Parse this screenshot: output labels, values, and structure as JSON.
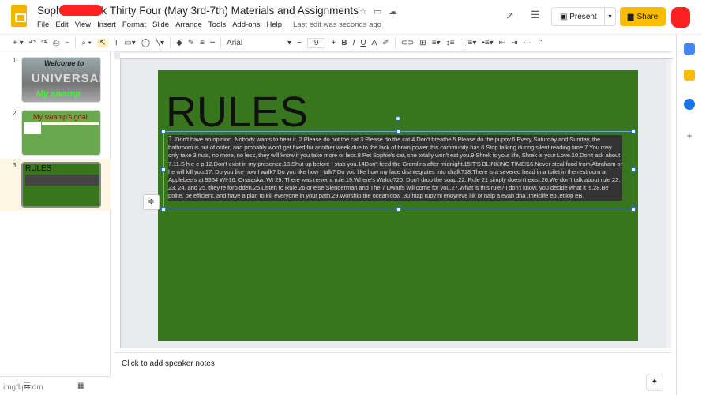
{
  "header": {
    "title": "Sophie      - Week Thirty Four (May 3rd-7th) Materials and Assignments",
    "menu": [
      "File",
      "Edit",
      "View",
      "Insert",
      "Format",
      "Slide",
      "Arrange",
      "Tools",
      "Add-ons",
      "Help"
    ],
    "last_edit": "Last edit was seconds ago",
    "present_label": "Present",
    "share_label": "Share"
  },
  "toolbar": {
    "font": "Arial",
    "font_size": "9",
    "bold": "B",
    "italic": "I",
    "underline": "U"
  },
  "filmstrip": {
    "slides": [
      {
        "number": "1",
        "title": "Welcome to",
        "subtitle": "My swamp",
        "image_text": "UNIVERSAL"
      },
      {
        "number": "2",
        "title": "My swamp's goal"
      },
      {
        "number": "3",
        "title": "RULES"
      }
    ]
  },
  "slide": {
    "title": "RULES",
    "list_number": "1.",
    "rules_text": "Don't have an opinion. Nobody wants to hear it. 2.Please do not the cat 3.Please do the cat.4.Don't breathe.5.Please do the puppy.6.Every Saturday and Sunday, the bathroom is out of order, and probably won't get fixed for another week due to the lack of brain power this community has.6.Stop talking during silent reading time.7.You may only take 3 nuts, no more, no less, they will know if you take more or less.8.Pet Sophie's cat, she totally won't eat you.9.Shrek is your life, Shrek is your Love.10.Don't ask about 7.11.S h e e p.12.Don't exist  in my presence.13.Shut up before I stab you.14Don't feed the Gremlins after midnight.15IT'S BLINKING TIME!16.Never steal food from Abraham or he will kill you.17. Do you like how I walk? Do you like how I talk? Do you like how my face disintegrates into chalk?18.There is a severed head in a toilet in the restroom at Applebee's at 9364 WI-16, Onalaska, WI 29; There was never a rule.19.Where's Waldo?20. Don't drop the soap.22. Rule 21 simply doesn't exist.26.We don't talk about rule 22, 23, 24, and 25, they're forbidden.25.Listen to Rule 26 or else Slenderman and The 7 Dwarfs will come for you.27.What is this rule? I don't know, you decide what it is.28.Be polite, be efficient, and have a plan to kill everyone in your path.29.Worship the ocean cow .30.htap rupy ni enoyreve llik ot nalp a evah dna ,tneicilfe eb ,etilop eB.",
    "background": "#38761d"
  },
  "notes": {
    "placeholder": "Click to add speaker notes"
  },
  "watermark": "imgflip.com",
  "colors": {
    "accent": "#fbbc04",
    "selection": "#1a73e8"
  }
}
